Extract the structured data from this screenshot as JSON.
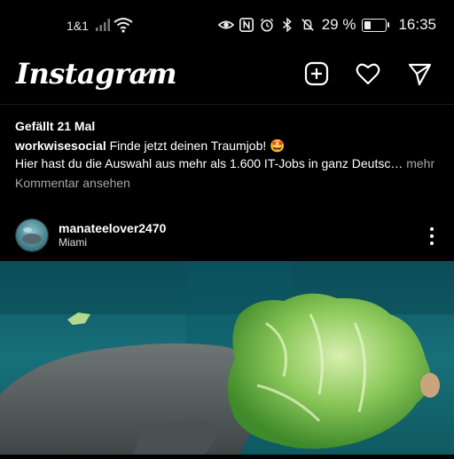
{
  "status_bar": {
    "carrier": "1&1",
    "battery_percent": "29 %",
    "battery_level": 0.29,
    "time": "16:35",
    "icons": [
      "signal-icon",
      "wifi-icon",
      "eye-icon",
      "nfc-icon",
      "alarm-icon",
      "bluetooth-icon",
      "mute-icon",
      "battery-icon"
    ]
  },
  "app_bar": {
    "logo": "Instagram",
    "icons": [
      "chevron-down-icon",
      "add-post-icon",
      "heart-icon",
      "direct-message-icon"
    ]
  },
  "previous_post": {
    "likes": "Gefällt 21 Mal",
    "caption_user": "workwisesocial",
    "caption_text": " Finde jetzt deinen Traumjob! 🤩",
    "caption_line2": "Hier hast du die Auswahl aus mehr als 1.600 IT-Jobs in ganz Deutsc…",
    "more_label": " mehr",
    "view_comments": "Kommentar ansehen"
  },
  "post": {
    "username": "manateelover2470",
    "location": "Miami",
    "icons": [
      "avatar",
      "more-options-icon"
    ],
    "image_subject": "manatee eating lettuce"
  }
}
